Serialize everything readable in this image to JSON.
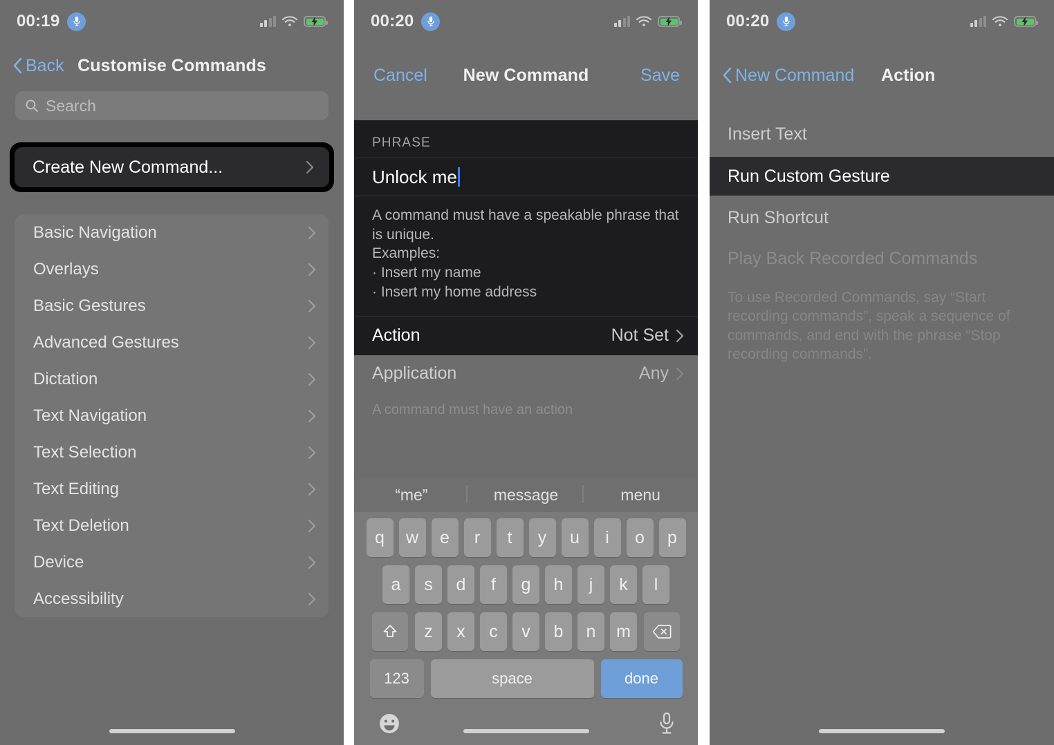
{
  "panel1": {
    "status": {
      "time": "00:19",
      "mic_icon": "microphone-icon",
      "signal_icon": "cellular-bars-icon",
      "wifi_icon": "wifi-icon",
      "battery_icon": "battery-charging-icon"
    },
    "nav": {
      "back_label": "Back",
      "title": "Customise Commands",
      "back_icon": "chevron-left-icon"
    },
    "search": {
      "placeholder": "Search",
      "icon": "search-icon"
    },
    "highlighted_row": {
      "label": "Create New Command...",
      "chevron": "chevron-right-icon"
    },
    "list": [
      {
        "label": "Basic Navigation"
      },
      {
        "label": "Overlays"
      },
      {
        "label": "Basic Gestures"
      },
      {
        "label": "Advanced Gestures"
      },
      {
        "label": "Dictation"
      },
      {
        "label": "Text Navigation"
      },
      {
        "label": "Text Selection"
      },
      {
        "label": "Text Editing"
      },
      {
        "label": "Text Deletion"
      },
      {
        "label": "Device"
      },
      {
        "label": "Accessibility"
      }
    ]
  },
  "panel2": {
    "status": {
      "time": "00:20"
    },
    "nav": {
      "cancel_label": "Cancel",
      "title": "New Command",
      "save_label": "Save"
    },
    "section_label": "PHRASE",
    "phrase_value": "Unlock me",
    "hint_line1": "A command must have a speakable phrase that is unique.",
    "hint_line2": "Examples:",
    "hint_bullet1": "· Insert my name",
    "hint_bullet2": "· Insert my home address",
    "action_row": {
      "key": "Action",
      "value": "Not Set",
      "chevron": "chevron-right-icon"
    },
    "application_row": {
      "key": "Application",
      "value": "Any",
      "chevron": "chevron-right-icon"
    },
    "subnote": "A command must have an action",
    "keyboard": {
      "suggestions": [
        "“me”",
        "message",
        "menu"
      ],
      "row1": [
        "q",
        "w",
        "e",
        "r",
        "t",
        "y",
        "u",
        "i",
        "o",
        "p"
      ],
      "row2": [
        "a",
        "s",
        "d",
        "f",
        "g",
        "h",
        "j",
        "k",
        "l"
      ],
      "row3": [
        "z",
        "x",
        "c",
        "v",
        "b",
        "n",
        "m"
      ],
      "shift_icon": "shift-arrow-icon",
      "backspace_icon": "backspace-icon",
      "numbers_label": "123",
      "space_label": "space",
      "return_label": "done",
      "emoji_icon": "emoji-smiley-icon",
      "dictate_icon": "microphone-icon"
    }
  },
  "panel3": {
    "status": {
      "time": "00:20"
    },
    "nav": {
      "back_label": "New Command",
      "title": "Action",
      "back_icon": "chevron-left-icon"
    },
    "options": [
      {
        "label": "Insert Text",
        "selected": false
      },
      {
        "label": "Run Custom Gesture",
        "selected": true
      },
      {
        "label": "Run Shortcut",
        "selected": false
      },
      {
        "label": "Play Back Recorded Commands",
        "selected": false
      }
    ],
    "footnote": "To use Recorded Commands, say “Start recording commands”, speak a sequence of commands, and end with the phrase “Stop recording commands”."
  },
  "colors": {
    "accent_blue": "#7fb2e8",
    "highlight_black": "#000000",
    "sheet_dark": "#1c1c1e",
    "panel_bg": "#6d6d6d",
    "battery_green": "#5cc46a"
  }
}
